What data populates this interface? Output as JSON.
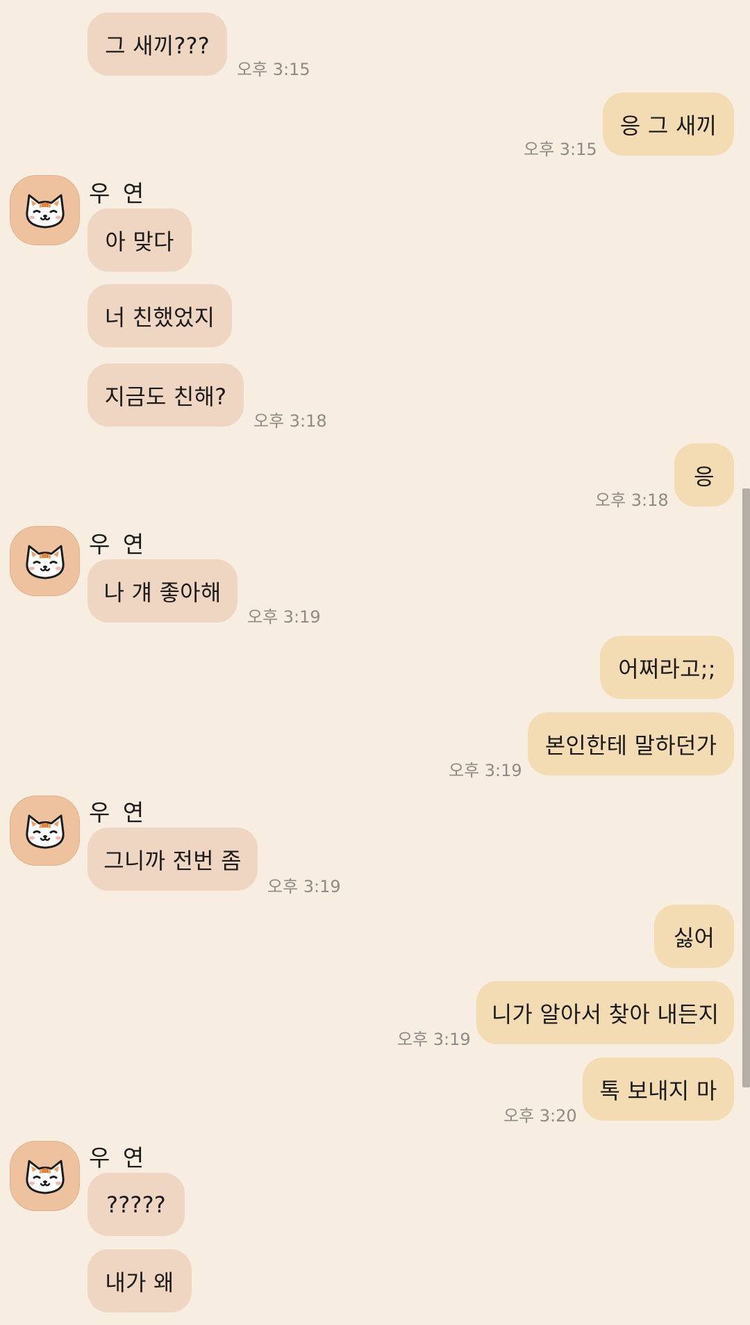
{
  "chat": {
    "messages": [
      {
        "text": "그 새끼???",
        "time": "오후 3:15"
      },
      {
        "text": "응 그 새끼",
        "time": "오후 3:15"
      },
      {
        "sender": "우 연",
        "text": "아 맞다"
      },
      {
        "text": "너 친했었지"
      },
      {
        "text": "지금도 친해?",
        "time": "오후 3:18"
      },
      {
        "text": "응",
        "time": "오후 3:18"
      },
      {
        "sender": "우 연",
        "text": "나 걔 좋아해",
        "time": "오후 3:19"
      },
      {
        "text": "어쩌라고;;"
      },
      {
        "text": "본인한테 말하던가",
        "time": "오후 3:19"
      },
      {
        "sender": "우 연",
        "text": "그니까 전번 좀",
        "time": "오후 3:19"
      },
      {
        "text": "싫어"
      },
      {
        "text": "니가 알아서 찾아 내든지",
        "time": "오후 3:19"
      },
      {
        "text": "톡 보내지 마",
        "time": "오후 3:20"
      },
      {
        "sender": "우 연",
        "text": "?????"
      },
      {
        "text": "내가 왜"
      }
    ]
  },
  "colors": {
    "background": "#f7ede1",
    "incoming_bubble": "#efd6c2",
    "outgoing_bubble": "#f3dbb3",
    "timestamp": "#8e8a86",
    "avatar_background": "#eec29e"
  },
  "icons": {
    "avatar": "orange-cat-face-icon"
  }
}
